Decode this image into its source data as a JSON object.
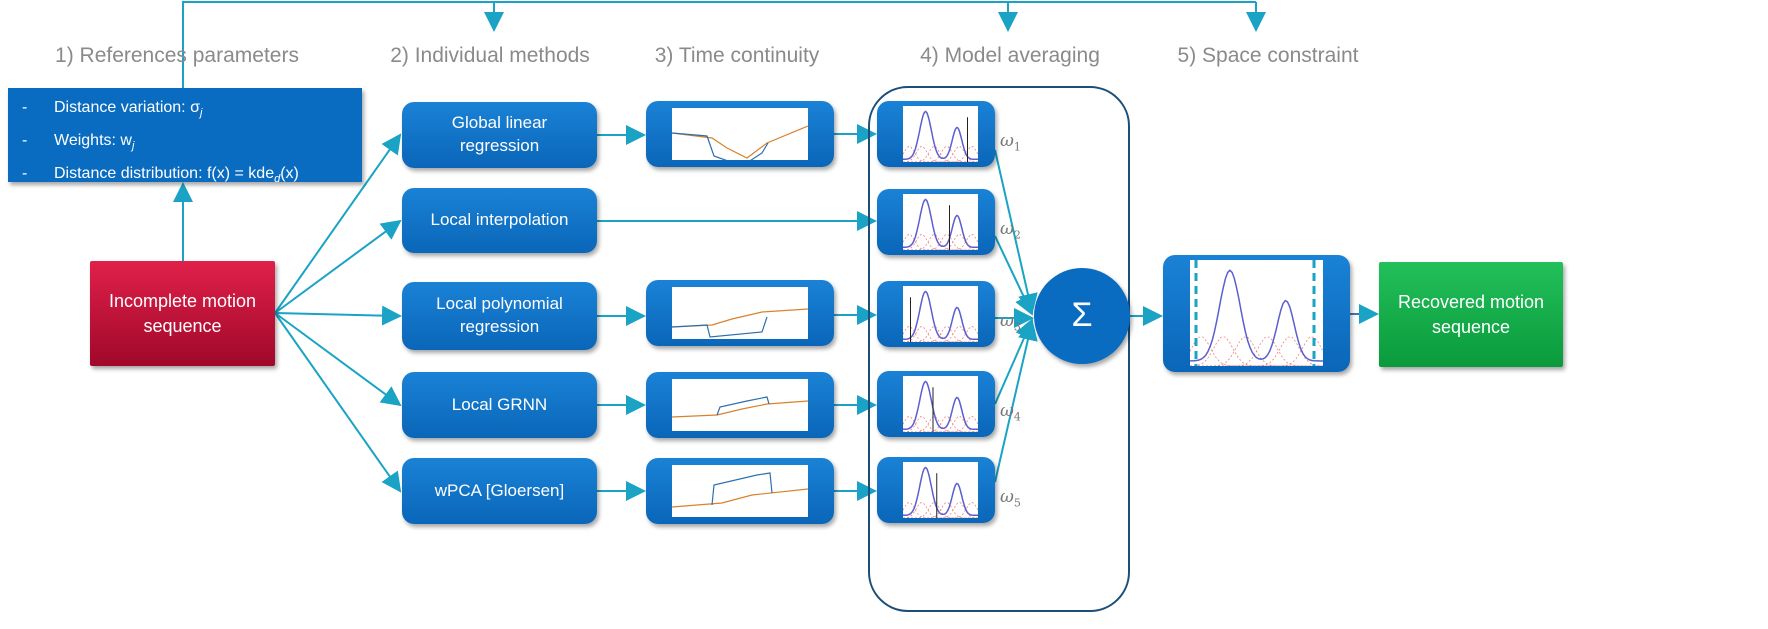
{
  "headings": [
    "1) References parameters",
    "2) Individual methods",
    "3) Time continuity",
    "4) Model averaging",
    "5) Space constraint"
  ],
  "params": {
    "items": [
      "Distance variation: σ",
      "Weights: w",
      "Distance distribution: f(x) = kde"
    ],
    "subs": [
      "j",
      "j",
      "d"
    ],
    "tail": [
      "",
      "",
      "(x)"
    ]
  },
  "input_label": "Incomplete motion sequence",
  "output_label": "Recovered motion sequence",
  "methods": [
    "Global linear regression",
    "Local interpolation",
    "Local polynomial regression",
    "Local GRNN",
    "wPCA [Gloersen]"
  ],
  "weights": [
    "ω",
    "ω",
    "ω",
    "ω",
    "ω"
  ],
  "weight_subs": [
    "1",
    "2",
    "3",
    "4",
    "5"
  ],
  "sum_symbol": "Σ",
  "colors": {
    "box_blue": "#0a6cc0",
    "arrow": "#1aa3c4",
    "input_red": "#c8103a",
    "output_green": "#14b04a",
    "kde_curve": "#5a5fd0",
    "kde_components": "#f08080"
  }
}
